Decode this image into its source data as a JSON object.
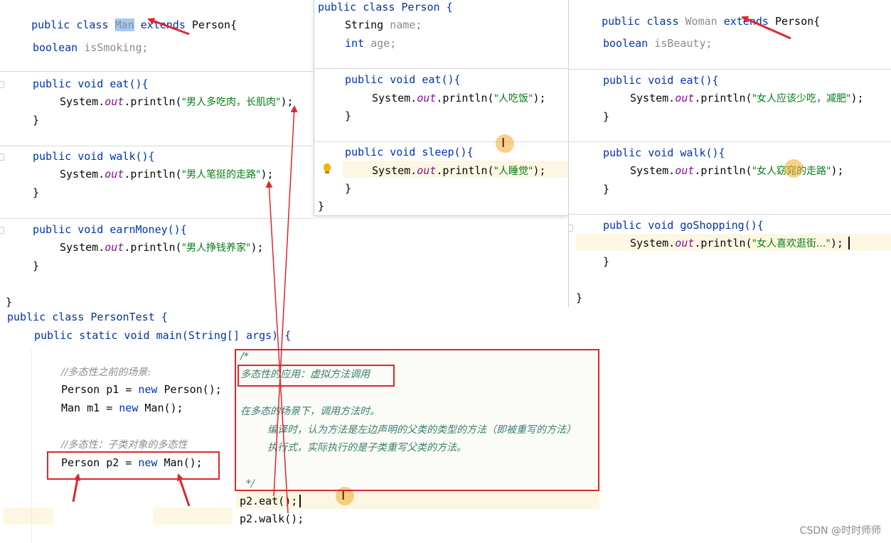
{
  "man_panel": {
    "class_decl": {
      "kw1": "public",
      "kw2": "class",
      "name": "Man",
      "kw3": "extends",
      "parent": "Person{"
    },
    "field": {
      "type": "boolean",
      "name": "isSmoking;"
    },
    "methods": [
      {
        "sig": "public void eat(){",
        "body_pre": "System.",
        "out": "out",
        "body_mid": ".println(",
        "str": "\"男人多吃肉，长肌肉\"",
        "body_post": ");",
        "close": "}"
      },
      {
        "sig": "public void walk(){",
        "body_pre": "System.",
        "out": "out",
        "body_mid": ".println(",
        "str": "\"男人笔挺的走路\"",
        "body_post": ");",
        "close": "}"
      },
      {
        "sig": "public void earnMoney(){",
        "body_pre": "System.",
        "out": "out",
        "body_mid": ".println(",
        "str": "\"男人挣钱养家\"",
        "body_post": ");",
        "close": "}"
      }
    ],
    "end": "}"
  },
  "person_panel": {
    "class_decl": "public class Person {",
    "fields": [
      {
        "type": "String",
        "name": "name;"
      },
      {
        "type": "int",
        "name": "age;"
      }
    ],
    "methods": [
      {
        "sig": "public void eat(){",
        "str": "\"人吃饭\"",
        "close": "}"
      },
      {
        "sig": "public void sleep(){",
        "str": "\"人睡觉\"",
        "close": "}"
      }
    ],
    "end": "}"
  },
  "woman_panel": {
    "class_decl": {
      "kw1": "public",
      "kw2": "class",
      "name": "Woman",
      "kw3": "extends",
      "parent": "Person{"
    },
    "field": {
      "type": "boolean",
      "name": "isBeauty;"
    },
    "methods": [
      {
        "sig": "public void eat(){",
        "str": "\"女人应该少吃，减肥\"",
        "close": "}"
      },
      {
        "sig": "public void walk(){",
        "str": "\"女人窈窕的走路\"",
        "close": "}"
      },
      {
        "sig": "public void goShopping(){",
        "str": "\"女人喜欢逛街...\"",
        "close": "}"
      }
    ],
    "end": "}"
  },
  "test_panel": {
    "class_decl": "public class PersonTest {",
    "main_sig": "public static void main(String[] args) {",
    "comment1": "//多态性之前的场景:",
    "p1_line": {
      "type": "Person",
      "var": "p1",
      "eq": "=",
      "kw": "new",
      "ctor": "Person();"
    },
    "m1_line": {
      "type": "Man",
      "var": "m1",
      "eq": "=",
      "kw": "new",
      "ctor": "Man();"
    },
    "comment2": "//多态性：子类对象的多态性",
    "p2_line": {
      "type": "Person",
      "var": "p2",
      "eq": "=",
      "kw": "new",
      "ctor": "Man();"
    },
    "block_comment": {
      "open": "/*",
      "title": "多态性的应用：虚拟方法调用",
      "line1": "在多态的场景下，调用方法时。",
      "line2": "编译时，认为方法是左边声明的父类的类型的方法（即被重写的方法）",
      "line3": "执行式，实际执行的是子类重写父类的方法。",
      "close": "*/"
    },
    "call1": "p2.eat();",
    "call2": "p2.walk();"
  },
  "common": {
    "sys": "System.",
    "out": "out",
    "println": ".println(",
    "end_paren": ");"
  },
  "watermark": "CSDN @时时师师",
  "colors": {
    "keyword": "#0033b3",
    "field": "#871094",
    "string": "#067d17",
    "annotation_red": "#e0262b"
  }
}
